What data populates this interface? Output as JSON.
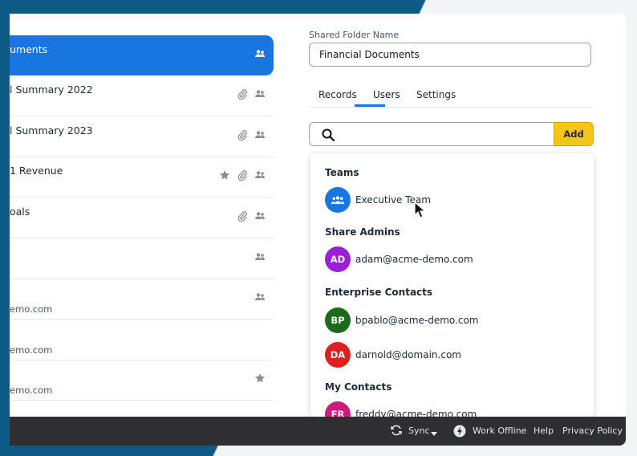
{
  "records": [
    {
      "title": "uments",
      "sub": "",
      "selected": true,
      "icons": [
        "shared-icon"
      ]
    },
    {
      "title": "l Summary 2022",
      "sub": "",
      "icons": [
        "attachment-icon",
        "shared-icon"
      ]
    },
    {
      "title": "l Summary 2023",
      "sub": "",
      "icons": [
        "attachment-icon",
        "shared-icon"
      ]
    },
    {
      "title": "1 Revenue",
      "sub": "",
      "icons": [
        "star-icon",
        "attachment-icon",
        "shared-icon"
      ]
    },
    {
      "title": "oals",
      "sub": "",
      "icons": [
        "attachment-icon",
        "shared-icon"
      ]
    },
    {
      "title": "",
      "sub": "",
      "icons": [
        "shared-icon"
      ]
    },
    {
      "title": "",
      "sub": "emo.com",
      "icons": [
        "shared-icon"
      ]
    },
    {
      "title": "",
      "sub": "emo.com",
      "icons": []
    },
    {
      "title": "",
      "sub": "emo.com",
      "icons": [
        "star-icon"
      ]
    }
  ],
  "panel": {
    "folder_label": "Shared Folder Name",
    "folder_value": "Financial Documents",
    "tabs": [
      "Records",
      "Users",
      "Settings"
    ],
    "active_tab": "Users",
    "search_placeholder": "",
    "add_label": "Add"
  },
  "dropdown": {
    "sections": [
      {
        "title": "Teams",
        "entries": [
          {
            "name": "Executive Team",
            "avatar": "team-icon",
            "color": "#1976e0"
          }
        ]
      },
      {
        "title": "Share Admins",
        "entries": [
          {
            "name": "adam@acme-demo.com",
            "initials": "AD",
            "color": "#9b1fd6"
          }
        ]
      },
      {
        "title": "Enterprise Contacts",
        "entries": [
          {
            "name": "bpablo@acme-demo.com",
            "initials": "BP",
            "color": "#1b6b1b"
          },
          {
            "name": "darnold@domain.com",
            "initials": "DA",
            "color": "#e01f1f"
          }
        ]
      },
      {
        "title": "My Contacts",
        "entries": [
          {
            "name": "freddy@acme-demo.com",
            "initials": "FR",
            "color": "#d0197a"
          }
        ]
      }
    ]
  },
  "footer": {
    "sync": "Sync",
    "work_offline": "Work Offline",
    "help": "Help",
    "privacy": "Privacy Policy"
  }
}
